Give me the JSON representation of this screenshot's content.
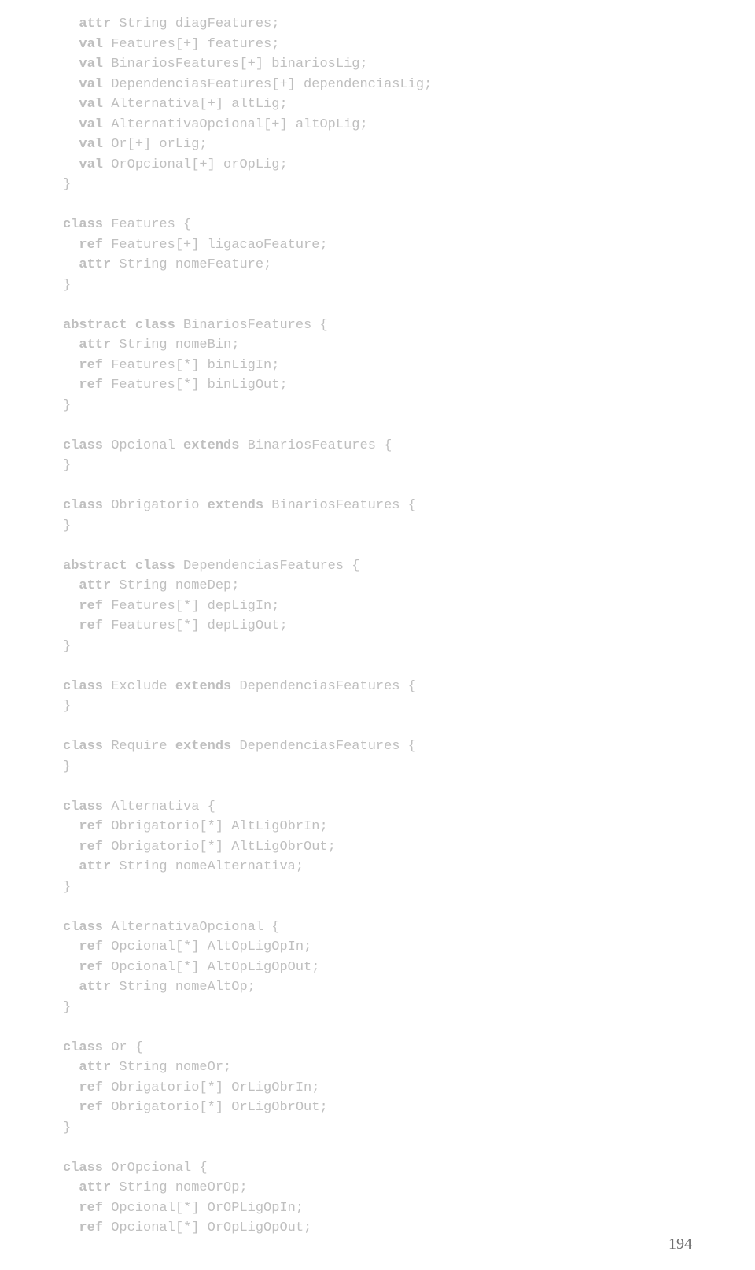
{
  "page_number": "194",
  "code_lines": [
    [
      [
        "kw",
        "  attr"
      ],
      [
        "",
        ". String diagFeatures;"
      ]
    ],
    [
      [
        "kw",
        "  val"
      ],
      [
        "",
        ". Features[+] features;"
      ]
    ],
    [
      [
        "kw",
        "  val"
      ],
      [
        "",
        ". BinariosFeatures[+] binariosLig;"
      ]
    ],
    [
      [
        "kw",
        "  val"
      ],
      [
        "",
        ". DependenciasFeatures[+] dependenciasLig;"
      ]
    ],
    [
      [
        "kw",
        "  val"
      ],
      [
        "",
        ". Alternativa[+] altLig;"
      ]
    ],
    [
      [
        "kw",
        "  val"
      ],
      [
        "",
        ". AlternativaOpcional[+] altOpLig;"
      ]
    ],
    [
      [
        "kw",
        "  val"
      ],
      [
        "",
        ". Or[+] orLig;"
      ]
    ],
    [
      [
        "kw",
        "  val"
      ],
      [
        "",
        ". OrOpcional[+] orOpLig;"
      ]
    ],
    [
      [
        "",
        ".}"
      ]
    ],
    [
      [
        "",
        ""
      ]
    ],
    [
      [
        "kw",
        "class"
      ],
      [
        "",
        ". Features {"
      ]
    ],
    [
      [
        "kw",
        "  ref"
      ],
      [
        "",
        ". Features[+] ligacaoFeature;"
      ]
    ],
    [
      [
        "kw",
        "  attr"
      ],
      [
        "",
        ". String nomeFeature;"
      ]
    ],
    [
      [
        "",
        ".}"
      ]
    ],
    [
      [
        "",
        ""
      ]
    ],
    [
      [
        "kw",
        "abstract class"
      ],
      [
        "",
        ". BinariosFeatures {"
      ]
    ],
    [
      [
        "kw",
        "  attr"
      ],
      [
        "",
        ". String nomeBin;"
      ]
    ],
    [
      [
        "kw",
        "  ref"
      ],
      [
        "",
        ". Features[*] binLigIn;"
      ]
    ],
    [
      [
        "kw",
        "  ref"
      ],
      [
        "",
        ". Features[*] binLigOut;"
      ]
    ],
    [
      [
        "",
        ".}"
      ]
    ],
    [
      [
        "",
        ""
      ]
    ],
    [
      [
        "kw",
        "class"
      ],
      [
        "",
        ". Opcional "
      ],
      [
        "kw",
        "extends"
      ],
      [
        "",
        ". BinariosFeatures {"
      ]
    ],
    [
      [
        "",
        ".}"
      ]
    ],
    [
      [
        "",
        ""
      ]
    ],
    [
      [
        "kw",
        "class"
      ],
      [
        "",
        ". Obrigatorio "
      ],
      [
        "kw",
        "extends"
      ],
      [
        "",
        ". BinariosFeatures {"
      ]
    ],
    [
      [
        "",
        ".}"
      ]
    ],
    [
      [
        "",
        ""
      ]
    ],
    [
      [
        "kw",
        "abstract class"
      ],
      [
        "",
        ". DependenciasFeatures {"
      ]
    ],
    [
      [
        "kw",
        "  attr"
      ],
      [
        "",
        ". String nomeDep;"
      ]
    ],
    [
      [
        "kw",
        "  ref"
      ],
      [
        "",
        ". Features[*] depLigIn;"
      ]
    ],
    [
      [
        "kw",
        "  ref"
      ],
      [
        "",
        ". Features[*] depLigOut;"
      ]
    ],
    [
      [
        "",
        ".}"
      ]
    ],
    [
      [
        "",
        ""
      ]
    ],
    [
      [
        "kw",
        "class"
      ],
      [
        "",
        ". Exclude "
      ],
      [
        "kw",
        "extends"
      ],
      [
        "",
        ". DependenciasFeatures {"
      ]
    ],
    [
      [
        "",
        ".}"
      ]
    ],
    [
      [
        "",
        ""
      ]
    ],
    [
      [
        "kw",
        "class"
      ],
      [
        "",
        ". Require "
      ],
      [
        "kw",
        "extends"
      ],
      [
        "",
        ". DependenciasFeatures {"
      ]
    ],
    [
      [
        "",
        ".}"
      ]
    ],
    [
      [
        "",
        ""
      ]
    ],
    [
      [
        "kw",
        "class"
      ],
      [
        "",
        ". Alternativa {"
      ]
    ],
    [
      [
        "kw",
        "  ref"
      ],
      [
        "",
        ". Obrigatorio[*] AltLigObrIn;"
      ]
    ],
    [
      [
        "kw",
        "  ref"
      ],
      [
        "",
        ". Obrigatorio[*] AltLigObrOut;"
      ]
    ],
    [
      [
        "kw",
        "  attr"
      ],
      [
        "",
        ". String nomeAlternativa;"
      ]
    ],
    [
      [
        "",
        ".}"
      ]
    ],
    [
      [
        "",
        ""
      ]
    ],
    [
      [
        "kw",
        "class"
      ],
      [
        "",
        ". AlternativaOpcional {"
      ]
    ],
    [
      [
        "kw",
        "  ref"
      ],
      [
        "",
        ". Opcional[*] AltOpLigOpIn;"
      ]
    ],
    [
      [
        "kw",
        "  ref"
      ],
      [
        "",
        ". Opcional[*] AltOpLigOpOut;"
      ]
    ],
    [
      [
        "kw",
        "  attr"
      ],
      [
        "",
        ". String nomeAltOp;"
      ]
    ],
    [
      [
        "",
        ".}"
      ]
    ],
    [
      [
        "",
        ""
      ]
    ],
    [
      [
        "kw",
        "class"
      ],
      [
        "",
        ". Or {"
      ]
    ],
    [
      [
        "kw",
        "  attr"
      ],
      [
        "",
        ". String nomeOr;"
      ]
    ],
    [
      [
        "kw",
        "  ref"
      ],
      [
        "",
        ". Obrigatorio[*] OrLigObrIn;"
      ]
    ],
    [
      [
        "kw",
        "  ref"
      ],
      [
        "",
        ". Obrigatorio[*] OrLigObrOut;"
      ]
    ],
    [
      [
        "",
        ".}"
      ]
    ],
    [
      [
        "",
        ""
      ]
    ],
    [
      [
        "kw",
        "class"
      ],
      [
        "",
        ". OrOpcional {"
      ]
    ],
    [
      [
        "kw",
        "  attr"
      ],
      [
        "",
        ". String nomeOrOp;"
      ]
    ],
    [
      [
        "kw",
        "  ref"
      ],
      [
        "",
        ". Opcional[*] OrOPLigOpIn;"
      ]
    ],
    [
      [
        "kw",
        "  ref"
      ],
      [
        "",
        ". Opcional[*] OrOpLigOpOut;"
      ]
    ]
  ]
}
